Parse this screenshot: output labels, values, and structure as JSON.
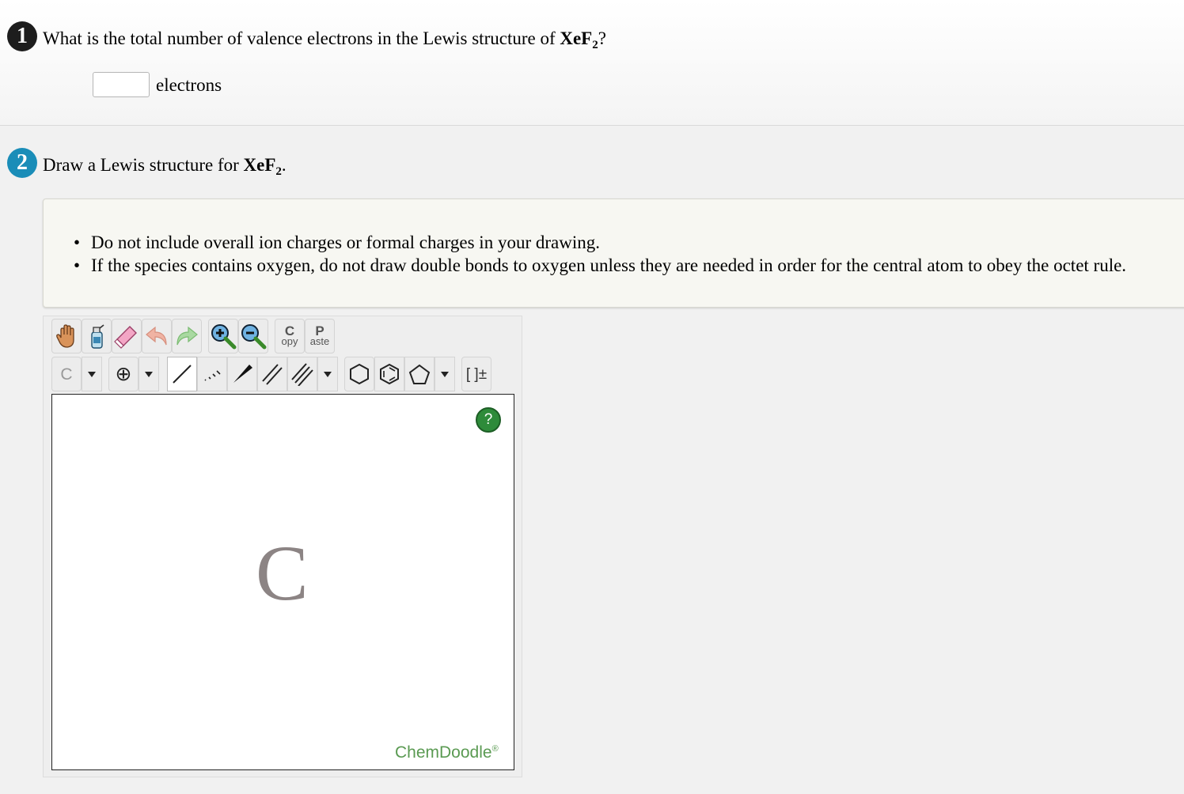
{
  "question1": {
    "number": "1",
    "text_prefix": "What is the total number of valence electrons in the Lewis structure of ",
    "formula_main": "XeF",
    "formula_sub": "2",
    "text_suffix": "?",
    "input_value": "",
    "unit_label": "electrons"
  },
  "question2": {
    "number": "2",
    "text_prefix": "Draw a Lewis structure for ",
    "formula_main": "XeF",
    "formula_sub": "2",
    "text_suffix": ".",
    "instructions": [
      "Do not include overall ion charges or formal charges in your drawing.",
      "If the species contains oxygen, do not draw double bonds to oxygen unless they are needed in order for the central atom to obey the octet rule."
    ]
  },
  "sketcher": {
    "toolbar_top": {
      "copy_top": "C",
      "copy_bottom": "opy",
      "paste_top": "P",
      "paste_bottom": "aste"
    },
    "toolbar_bottom": {
      "element_label": "C",
      "charge_label": "⊕",
      "bracket_label": "[ ]±"
    },
    "canvas_atom": "C",
    "help_label": "?",
    "brand": "ChemDoodle",
    "brand_mark": "®"
  },
  "colors": {
    "q2_badge": "#1a8db8",
    "help_button": "#2e8b3a",
    "brand_text": "#5a9a52"
  }
}
